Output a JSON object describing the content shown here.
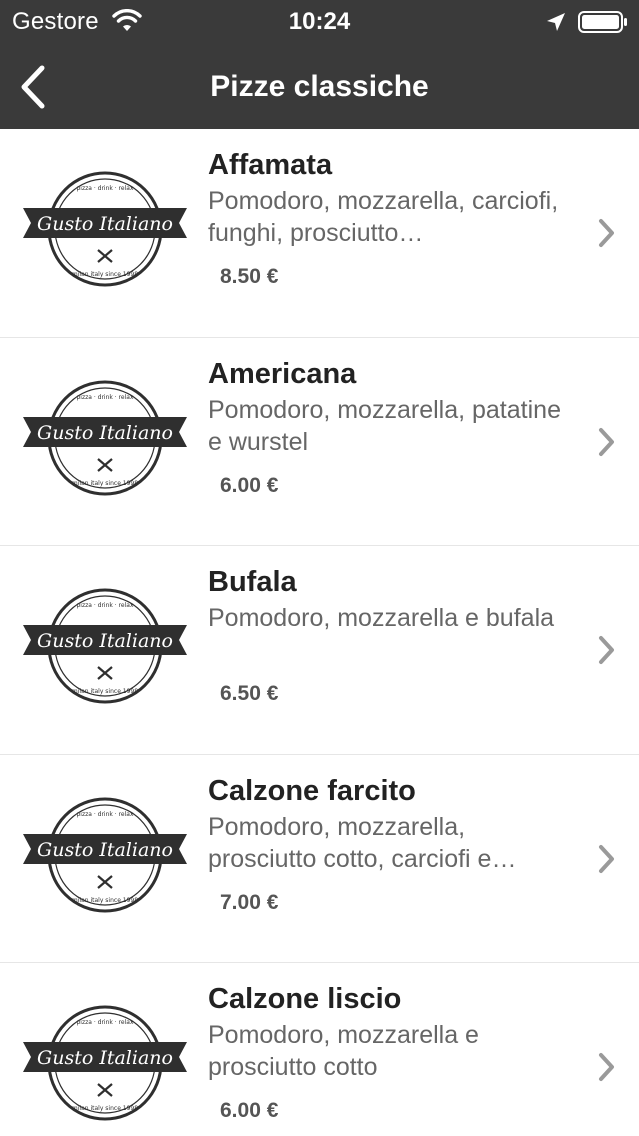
{
  "status_bar": {
    "carrier": "Gestore",
    "time": "10:24"
  },
  "nav": {
    "title": "Pizze classiche",
    "back_icon": "chevron-left-icon"
  },
  "logo": {
    "brand": "Gusto Italiano",
    "top_text": "pizza · drink · relax",
    "bottom_text": "milan italy since 1998"
  },
  "menu_items": [
    {
      "name": "Affamata",
      "description": "Pomodoro, mozzarella, carciofi, funghi, prosciutto…",
      "price": "8.50 €"
    },
    {
      "name": "Americana",
      "description": "Pomodoro, mozzarella, patatine e wurstel",
      "price": "6.00 €"
    },
    {
      "name": "Bufala",
      "description": "Pomodoro, mozzarella e bufala",
      "price": "6.50 €"
    },
    {
      "name": "Calzone farcito",
      "description": "Pomodoro, mozzarella, prosciutto cotto, carciofi e…",
      "price": "7.00 €"
    },
    {
      "name": "Calzone liscio",
      "description": "Pomodoro, mozzarella e prosciutto cotto",
      "price": "6.00 €"
    }
  ],
  "colors": {
    "bar_background": "#3a3a3a",
    "row_border": "#e6e6e6",
    "chevron": "#9a9a9a",
    "logo_dark": "#2f2f2f"
  }
}
